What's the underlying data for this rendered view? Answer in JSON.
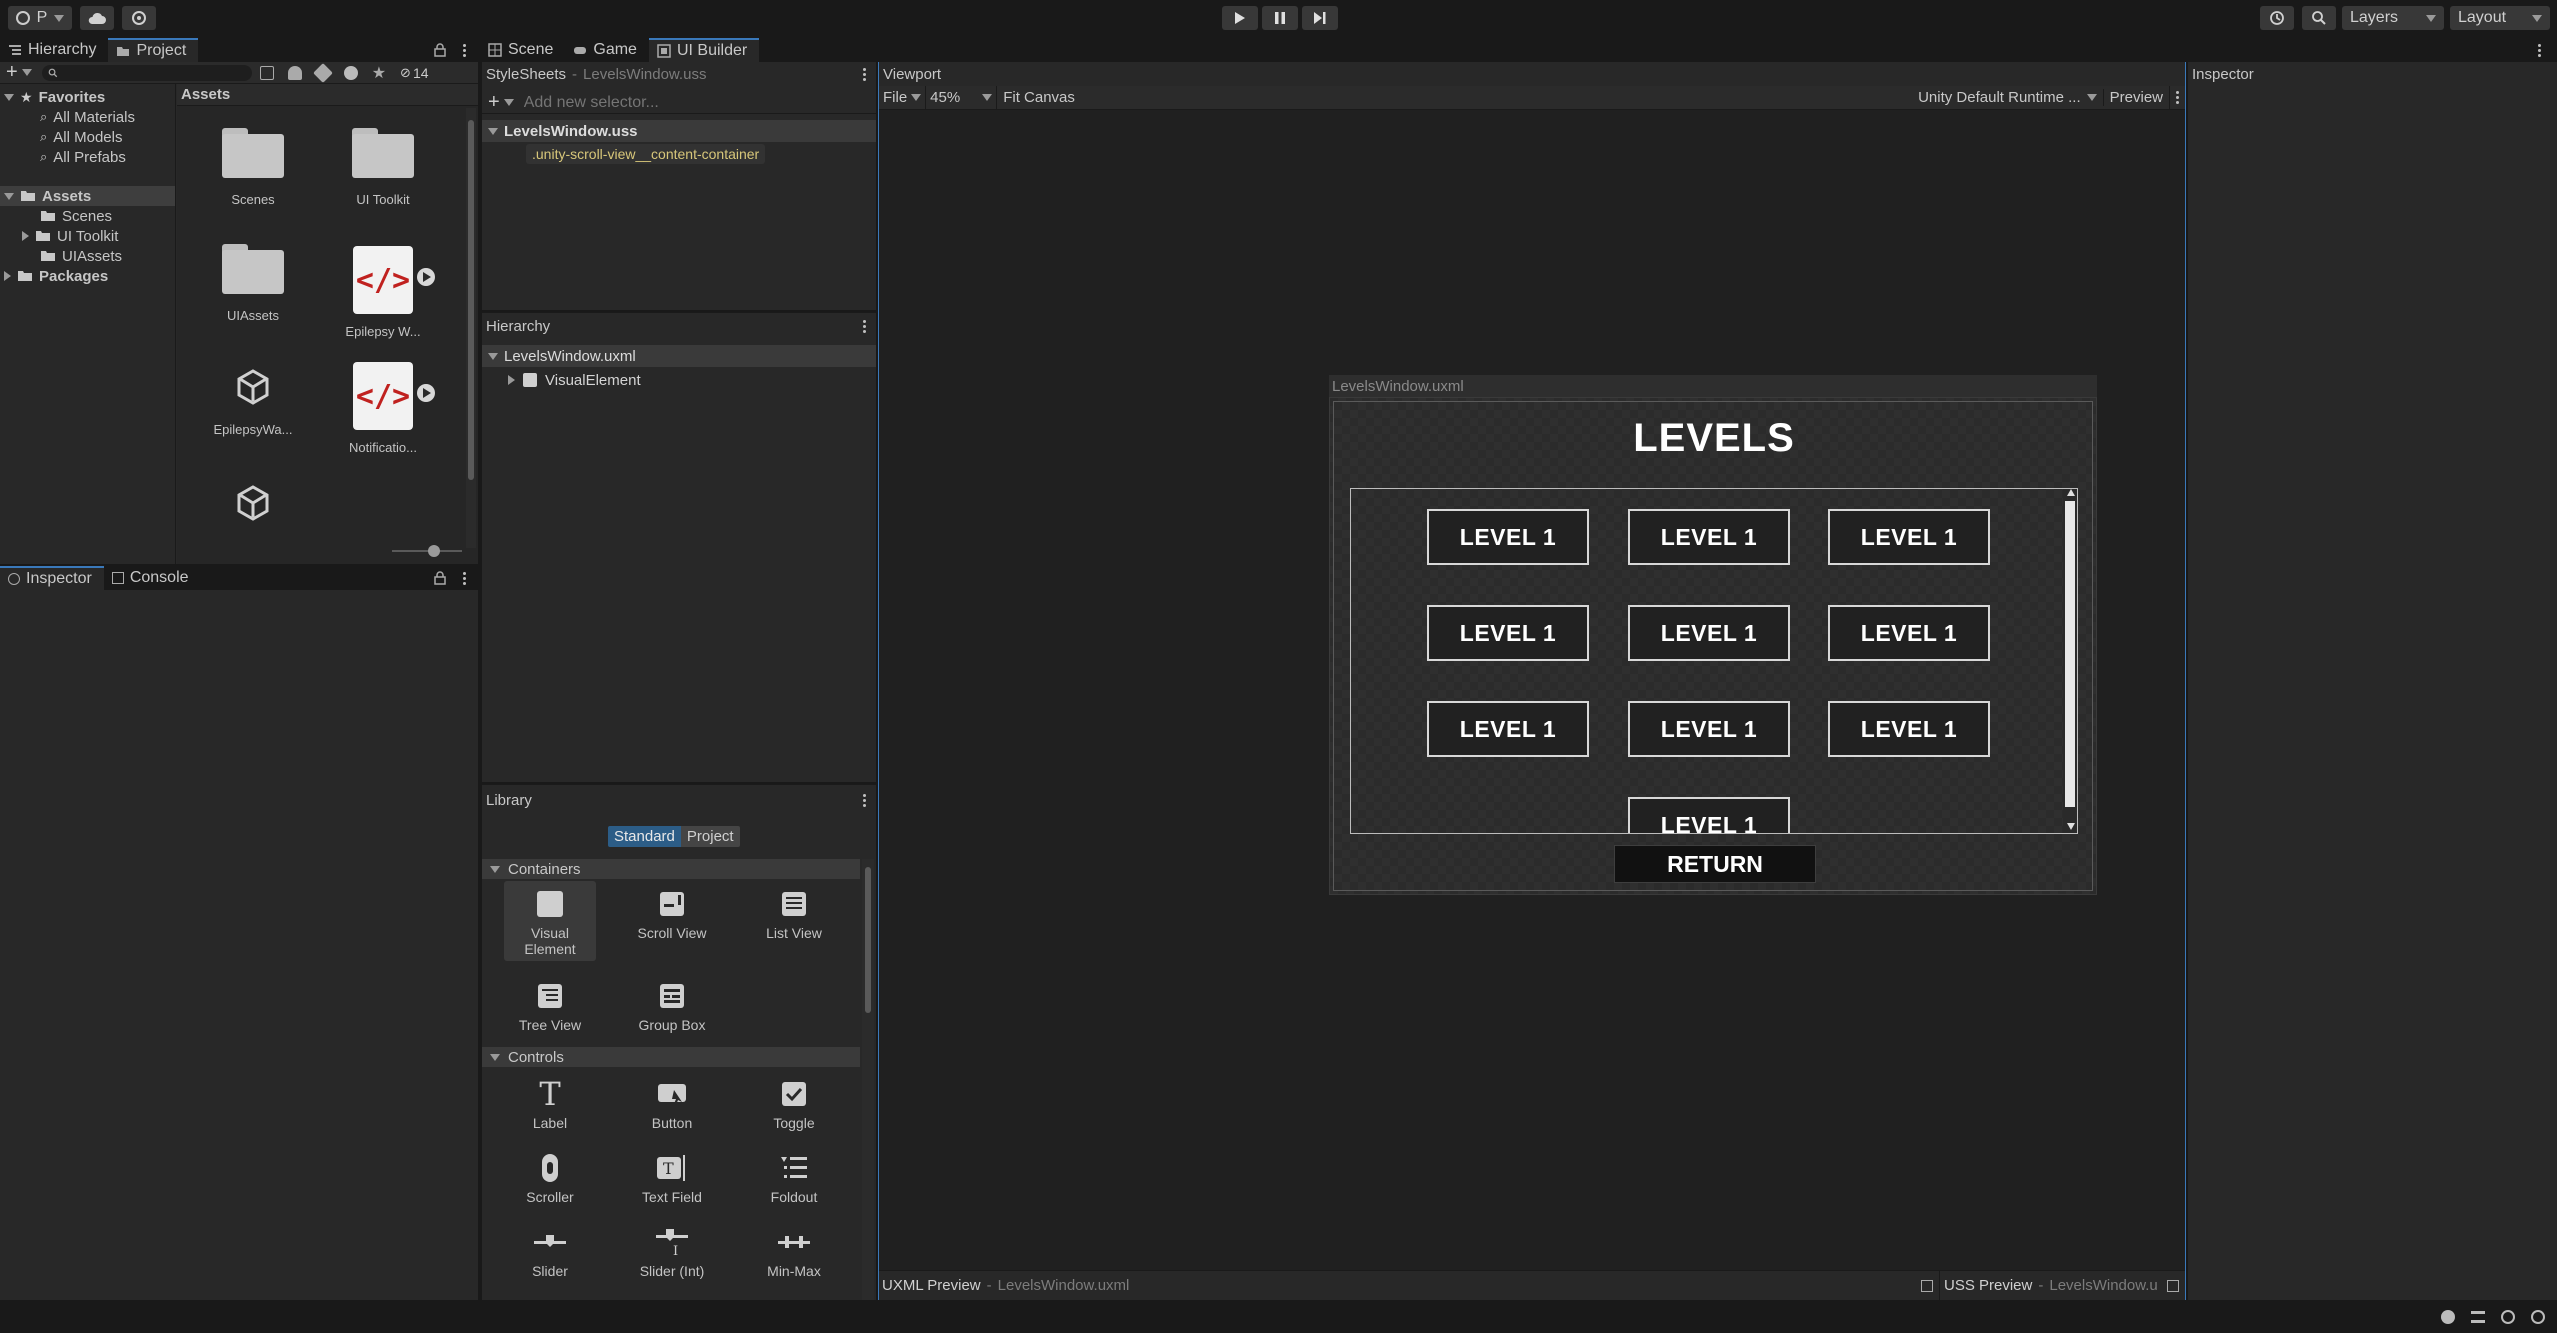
{
  "toolbar": {
    "account_label": "P",
    "layers_label": "Layers",
    "layout_label": "Layout"
  },
  "left_tabs": {
    "hierarchy": "Hierarchy",
    "project": "Project"
  },
  "project": {
    "visible_count": "14",
    "favorites_label": "Favorites",
    "favorites": [
      "All Materials",
      "All Models",
      "All Prefabs"
    ],
    "assets_label": "Assets",
    "assets_children": [
      "Scenes",
      "UI Toolkit",
      "UIAssets"
    ],
    "packages_label": "Packages",
    "grid_header": "Assets",
    "items": [
      {
        "name": "Scenes",
        "kind": "folder"
      },
      {
        "name": "UI Toolkit",
        "kind": "folder"
      },
      {
        "name": "UIAssets",
        "kind": "folder"
      },
      {
        "name": "Epilepsy W...",
        "kind": "code"
      },
      {
        "name": "EpilepsyWa...",
        "kind": "unity"
      },
      {
        "name": "Notificatio...",
        "kind": "code"
      },
      {
        "name": "",
        "kind": "unity"
      }
    ]
  },
  "bottom_left_tabs": {
    "inspector": "Inspector",
    "console": "Console"
  },
  "center_tabs": {
    "scene": "Scene",
    "game": "Game",
    "ui_builder": "UI Builder"
  },
  "stylesheets": {
    "title": "StyleSheets",
    "subtitle": "LevelsWindow.uss",
    "selector_placeholder": "Add new selector...",
    "file": "LevelsWindow.uss",
    "selector": ".unity-scroll-view__content-container"
  },
  "builder_hierarchy": {
    "title": "Hierarchy",
    "file": "LevelsWindow.uxml",
    "child": "VisualElement"
  },
  "library": {
    "title": "Library",
    "tabs": [
      "Standard",
      "Project"
    ],
    "containers_label": "Containers",
    "containers": [
      "Visual Element",
      "Scroll View",
      "List View",
      "Tree View",
      "Group Box"
    ],
    "controls_label": "Controls",
    "controls": [
      "Label",
      "Button",
      "Toggle",
      "Scroller",
      "Text Field",
      "Foldout",
      "Slider",
      "Slider (Int)",
      "Min-Max"
    ]
  },
  "viewport": {
    "title": "Viewport",
    "file_menu": "File",
    "zoom": "45%",
    "fit_canvas": "Fit Canvas",
    "theme": "Unity Default Runtime ...",
    "preview": "Preview",
    "canvas_title": "LevelsWindow.uxml",
    "uxml_preview": "UXML Preview",
    "uxml_preview_file": "LevelsWindow.uxml",
    "uss_preview": "USS Preview",
    "uss_preview_file": "LevelsWindow.u"
  },
  "game_ui": {
    "heading": "LEVELS",
    "levels": [
      "LEVEL 1",
      "LEVEL 1",
      "LEVEL 1",
      "LEVEL 1",
      "LEVEL 1",
      "LEVEL 1",
      "LEVEL 1",
      "LEVEL 1",
      "LEVEL 1",
      "LEVEL 1"
    ],
    "return_label": "RETURN"
  },
  "inspector": {
    "title": "Inspector"
  },
  "colors": {
    "accent": "#3a79bb",
    "selection": "#2c5d87",
    "selector_text": "#d8c77a",
    "code_icon": "#c0211f"
  }
}
